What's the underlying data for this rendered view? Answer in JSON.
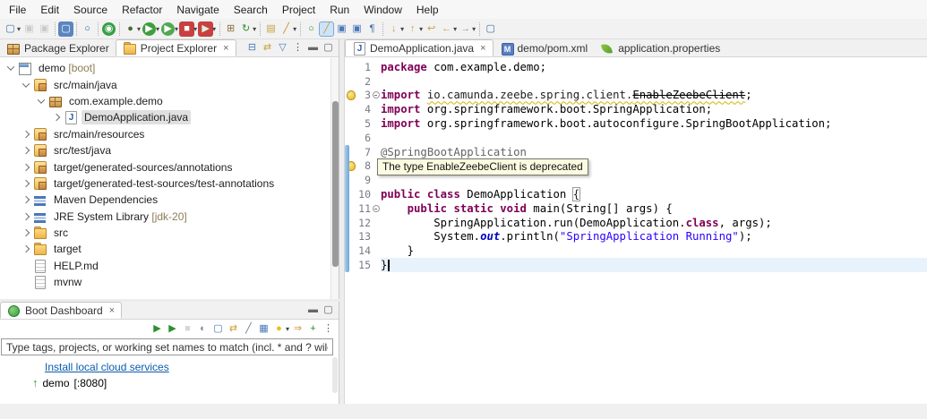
{
  "menu": {
    "items": [
      "File",
      "Edit",
      "Source",
      "Refactor",
      "Navigate",
      "Search",
      "Project",
      "Run",
      "Window",
      "Help"
    ]
  },
  "glyphs": {
    "close": "×",
    "dropdown": "▾"
  },
  "colors": {
    "keyword": "#7f0055",
    "string": "#2a00ff",
    "annotation": "#646464",
    "link": "#0b5cad",
    "decoration": "#8d7d56",
    "selection": "#e0e0e0",
    "current_line": "#e8f2fd",
    "warning": "#e8b71f"
  },
  "main_toolbar": {
    "icons": [
      {
        "n": "new-wizard",
        "g": "▢",
        "c": "#3b6ea5",
        "dd": 1
      },
      {
        "n": "save",
        "g": "▣",
        "c": "#9a9a9a",
        "dis": 1
      },
      {
        "n": "save-all",
        "g": "▣",
        "c": "#9a9a9a",
        "dis": 1,
        "sep": 1
      },
      {
        "n": "open-console",
        "g": "▢",
        "c": "#ffffff",
        "bg": "#5b85c0",
        "sep": 1
      },
      {
        "n": "search",
        "g": "○",
        "c": "#2f5f9e",
        "sep": 1
      },
      {
        "n": "boot-restart",
        "g": "◉",
        "c": "#ffffff",
        "bg": "#35a046",
        "round": 1,
        "sep": 1
      },
      {
        "n": "debug",
        "g": "●",
        "c": "#4a6b2a",
        "dd": 1
      },
      {
        "n": "run",
        "g": "▶",
        "c": "#ffffff",
        "bg": "#3f9e3f",
        "round": 1,
        "dd": 1
      },
      {
        "n": "run-coverage",
        "g": "▶",
        "c": "#ffffff",
        "bg": "#52a852",
        "round": 1,
        "dd": 1
      },
      {
        "n": "stop",
        "g": "■",
        "c": "#ffffff",
        "bg": "#c84040",
        "dd": 1
      },
      {
        "n": "relaunch",
        "g": "▶",
        "c": "#dff0df",
        "bg": "#c84040",
        "dd": 1,
        "sep": 1
      },
      {
        "n": "new-java-project",
        "g": "⊞",
        "c": "#8a6d3b"
      },
      {
        "n": "update-maven-project",
        "g": "↻",
        "c": "#2f8f2f",
        "dd": 1,
        "sep": 1
      },
      {
        "n": "open-resource",
        "g": "▤",
        "c": "#c8a23c"
      },
      {
        "n": "toggle-highlight",
        "g": "╱",
        "c": "#d08a2c",
        "dd": 1,
        "sep": 1
      },
      {
        "n": "plugin-search",
        "g": "○",
        "c": "#2f8f2f"
      },
      {
        "n": "mark-occurrences",
        "g": "╱",
        "c": "#c8a23c",
        "act": 1
      },
      {
        "n": "show-annotations",
        "g": "▣",
        "c": "#4a78b8"
      },
      {
        "n": "open-declaration",
        "g": "▣",
        "c": "#4a78b8"
      },
      {
        "n": "show-whitespace",
        "g": "¶",
        "c": "#3b6ea5",
        "sep": 1
      },
      {
        "n": "next-annotation",
        "g": "↓",
        "c": "#c8a23c",
        "dd": 1
      },
      {
        "n": "previous-annotation",
        "g": "↑",
        "c": "#c8a23c",
        "dd": 1
      },
      {
        "n": "last-edit-location",
        "g": "↩",
        "c": "#c8a23c"
      },
      {
        "n": "back",
        "g": "←",
        "c": "#c8a23c",
        "dd": 1
      },
      {
        "n": "forward",
        "g": "→",
        "c": "#9a9a9a",
        "dd": 1,
        "sep": 1
      },
      {
        "n": "new-untitled-file",
        "g": "▢",
        "c": "#3b6ea5"
      }
    ]
  },
  "explorer": {
    "tabs": [
      {
        "label": "Package Explorer",
        "icon": "pkg",
        "active": false,
        "closable": false
      },
      {
        "label": "Project Explorer",
        "icon": "folder",
        "active": true,
        "closable": true
      }
    ],
    "view_icons": [
      {
        "n": "collapse-all",
        "g": "⊟",
        "c": "#4a78b8"
      },
      {
        "n": "link-with-editor",
        "g": "⇄",
        "c": "#c8a23c"
      },
      {
        "n": "filters",
        "g": "▽",
        "c": "#4a78b8"
      },
      {
        "n": "view-menu",
        "g": "⋮",
        "c": "#555555"
      },
      {
        "n": "minimize",
        "g": "▬",
        "c": "#666666"
      },
      {
        "n": "maximize",
        "g": "▢",
        "c": "#666666"
      }
    ],
    "tree": [
      {
        "label": "demo",
        "dec": "[boot]",
        "depth": 0,
        "chev": "open",
        "icon": "proj"
      },
      {
        "label": "src/main/java",
        "depth": 1,
        "chev": "open",
        "icon": "srcfolder"
      },
      {
        "label": "com.example.demo",
        "depth": 2,
        "chev": "open",
        "icon": "pkg"
      },
      {
        "label": "DemoApplication.java",
        "depth": 3,
        "chev": "closed",
        "icon": "jfile",
        "selected": true
      },
      {
        "label": "src/main/resources",
        "depth": 1,
        "chev": "closed",
        "icon": "srcfolder"
      },
      {
        "label": "src/test/java",
        "depth": 1,
        "chev": "closed",
        "icon": "srcfolder"
      },
      {
        "label": "target/generated-sources/annotations",
        "depth": 1,
        "chev": "closed",
        "icon": "srcfolder"
      },
      {
        "label": "target/generated-test-sources/test-annotations",
        "depth": 1,
        "chev": "closed",
        "icon": "srcfolder"
      },
      {
        "label": "Maven Dependencies",
        "depth": 1,
        "chev": "closed",
        "icon": "lib"
      },
      {
        "label": "JRE System Library",
        "dec": "[jdk-20]",
        "depth": 1,
        "chev": "closed",
        "icon": "lib"
      },
      {
        "label": "src",
        "depth": 1,
        "chev": "closed",
        "icon": "folder"
      },
      {
        "label": "target",
        "depth": 1,
        "chev": "closed",
        "icon": "folder"
      },
      {
        "label": "HELP.md",
        "depth": 1,
        "chev": "none",
        "icon": "file"
      },
      {
        "label": "mvnw",
        "depth": 1,
        "chev": "none",
        "icon": "file"
      }
    ]
  },
  "editor": {
    "tabs": [
      {
        "label": "DemoApplication.java",
        "icon": "jfile",
        "active": true,
        "closable": true
      },
      {
        "label": "demo/pom.xml",
        "icon": "mfile",
        "active": false,
        "closable": false
      },
      {
        "label": "application.properties",
        "icon": "leaf",
        "active": false,
        "closable": false
      }
    ],
    "tooltip": "The type EnableZeebeClient is deprecated",
    "code_lines": [
      {
        "n": "1",
        "t": [
          [
            "k",
            "package"
          ],
          [
            "d",
            " com.example.demo;"
          ]
        ]
      },
      {
        "n": "2",
        "t": []
      },
      {
        "n": "3",
        "warn": true,
        "fold": true,
        "t": [
          [
            "k",
            "import"
          ],
          [
            "d",
            " "
          ],
          [
            "w",
            "io.camunda.zeebe.spring.client."
          ],
          [
            "x",
            "EnableZeebeClient"
          ],
          [
            "d",
            ";"
          ]
        ]
      },
      {
        "n": "4",
        "t": [
          [
            "k",
            "import"
          ],
          [
            "d",
            " org.springframework.boot.SpringApplication;"
          ]
        ]
      },
      {
        "n": "5",
        "t": [
          [
            "k",
            "import"
          ],
          [
            "d",
            " org.springframework.boot.autoconfigure.SpringBootApplication;"
          ]
        ]
      },
      {
        "n": "6",
        "t": []
      },
      {
        "n": "7",
        "t": [
          [
            "a",
            "@SpringBootApplication"
          ]
        ]
      },
      {
        "n": "8",
        "warn": true,
        "t": []
      },
      {
        "n": "9",
        "t": []
      },
      {
        "n": "10",
        "t": [
          [
            "k",
            "public"
          ],
          [
            "d",
            " "
          ],
          [
            "k",
            "class"
          ],
          [
            "d",
            " DemoApplication "
          ],
          [
            "b",
            "{"
          ]
        ]
      },
      {
        "n": "11",
        "fold": true,
        "t": [
          [
            "d",
            "    "
          ],
          [
            "k",
            "public"
          ],
          [
            "d",
            " "
          ],
          [
            "k",
            "static"
          ],
          [
            "d",
            " "
          ],
          [
            "k",
            "void"
          ],
          [
            "d",
            " main(String[] args) {"
          ]
        ]
      },
      {
        "n": "12",
        "t": [
          [
            "d",
            "        SpringApplication.run(DemoApplication."
          ],
          [
            "k",
            "class"
          ],
          [
            "d",
            ", args);"
          ]
        ]
      },
      {
        "n": "13",
        "t": [
          [
            "d",
            "        System."
          ],
          [
            "f",
            "out"
          ],
          [
            "d",
            ".println("
          ],
          [
            "s",
            "\"SpringApplication Running\""
          ],
          [
            "d",
            ");"
          ]
        ]
      },
      {
        "n": "14",
        "t": [
          [
            "d",
            "    }"
          ]
        ]
      },
      {
        "n": "15",
        "cur": true,
        "caret": true,
        "t": [
          [
            "d",
            "}"
          ]
        ]
      }
    ]
  },
  "boot": {
    "tab_label": "Boot Dashboard",
    "window_icons": [
      {
        "n": "minimize",
        "g": "▬",
        "c": "#666666"
      },
      {
        "n": "maximize",
        "g": "▢",
        "c": "#666666"
      }
    ],
    "view_icons": [
      {
        "n": "start",
        "g": "▶",
        "c": "#2f8f2f"
      },
      {
        "n": "start-with-profile",
        "g": "▶",
        "c": "#2f8f2f"
      },
      {
        "n": "stop",
        "g": "■",
        "c": "#aaaaaa",
        "dis": 1
      },
      {
        "n": "pause",
        "g": "◐",
        "c": "#7a8aa0"
      },
      {
        "n": "open-console",
        "g": "▢",
        "c": "#4a78b8"
      },
      {
        "n": "redeploy",
        "g": "⇄",
        "c": "#c8a23c"
      },
      {
        "n": "open-config",
        "g": "╱",
        "c": "#6a7b8c"
      },
      {
        "n": "open-properties",
        "g": "▦",
        "c": "#4a78b8"
      },
      {
        "n": "boot-hints",
        "g": "●",
        "c": "#e8c020",
        "dd": 1
      },
      {
        "n": "filter",
        "g": "⇒",
        "c": "#d08a2c"
      },
      {
        "n": "add-target",
        "g": "+",
        "c": "#2f8f2f"
      },
      {
        "n": "view-menu",
        "g": "⋮",
        "c": "#555555"
      }
    ],
    "filter_text": "Type tags, projects, or working set names to match (incl. * and ? wildc",
    "link_label": "Install local cloud services",
    "app_name": "demo",
    "app_decoration": "[:8080]"
  }
}
